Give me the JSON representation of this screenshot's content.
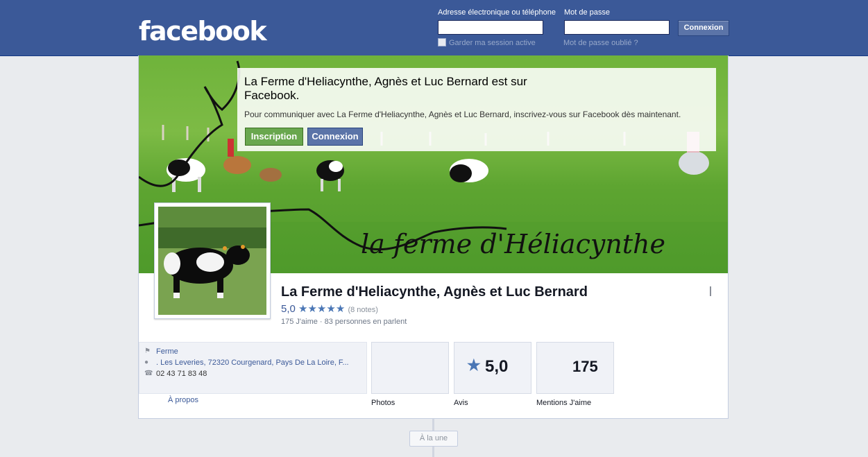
{
  "header": {
    "logo": "facebook",
    "email_label": "Adresse électronique ou téléphone",
    "password_label": "Mot de passe",
    "login_button": "Connexion",
    "keep_logged_in": "Garder ma session active",
    "forgot_password": "Mot de passe oublié ?",
    "email_value": "",
    "password_value": ""
  },
  "cover": {
    "caption": "la ferme d'Héliacynthe"
  },
  "signup_box": {
    "title": "La Ferme d'Heliacynthe, Agnès et Luc Bernard est sur Facebook.",
    "text": "Pour communiquer avec La Ferme d'Heliacynthe, Agnès et Luc Bernard, inscrivez-vous sur Facebook dès maintenant.",
    "signup_button": "Inscription",
    "login_button": "Connexion"
  },
  "page": {
    "name": "La Ferme d'Heliacynthe, Agnès et Luc Bernard",
    "rating": "5,0",
    "stars": "★★★★★",
    "rating_count": "(8 notes)",
    "likes_line": "175 J'aime · 83 personnes en parlent"
  },
  "about": {
    "category": "Ferme",
    "address": ". Les Leveries, 72320 Courgenard, Pays De La Loire, F...",
    "phone": "02 43 71 83 48",
    "link": "À propos"
  },
  "tiles": {
    "photos_label": "Photos",
    "reviews_label": "Avis",
    "reviews_value": "5,0",
    "likes_label": "Mentions J'aime",
    "likes_value": "175"
  },
  "timeline": {
    "button": "À la une"
  },
  "colors": {
    "brand": "#3b5998",
    "green_button": "#69a74e",
    "star": "#4a76b5"
  }
}
